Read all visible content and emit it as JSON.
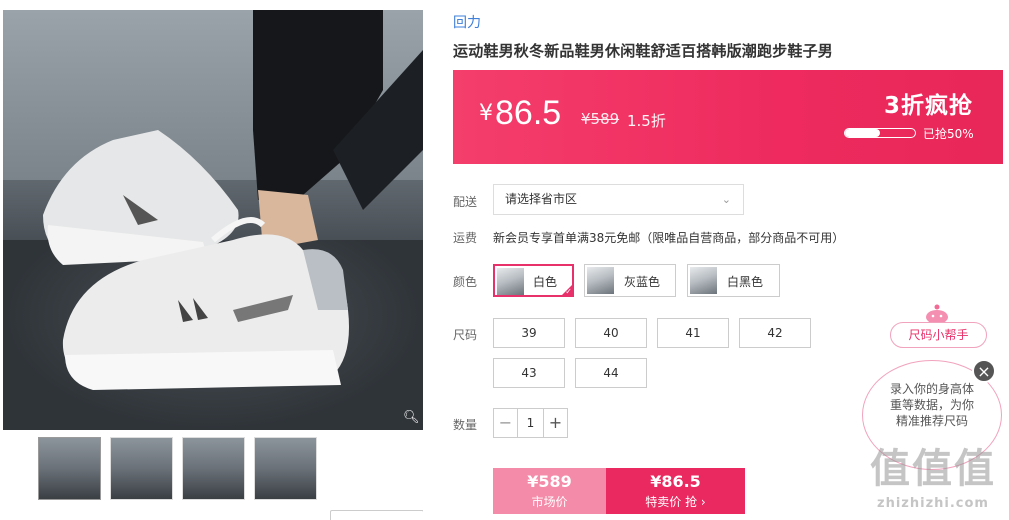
{
  "product": {
    "brand": "回力",
    "title": "运动鞋男秋冬新品鞋男休闲鞋舒适百搭韩版潮跑步鞋子男"
  },
  "price_banner": {
    "currency": "¥",
    "price": "86.5",
    "original_price": "¥589",
    "discount": "1.5折",
    "flash_label": "3折疯抢",
    "sold_progress": 0.5,
    "sold_text": "已抢50%"
  },
  "delivery": {
    "label": "配送",
    "select_value": "请选择省市区"
  },
  "shipping": {
    "label": "运费",
    "text": "新会员专享首单满38元免邮（限唯品自营商品，部分商品不可用）"
  },
  "colors": {
    "label": "颜色",
    "options": [
      {
        "name": "白色",
        "selected": true
      },
      {
        "name": "灰蓝色",
        "selected": false
      },
      {
        "name": "白黑色",
        "selected": false
      }
    ]
  },
  "sizes": {
    "label": "尺码",
    "options": [
      "39",
      "40",
      "41",
      "42",
      "43",
      "44"
    ]
  },
  "quantity": {
    "label": "数量",
    "value": "1",
    "minus": "−",
    "plus": "+"
  },
  "buy": {
    "market_price": "¥589",
    "market_label": "市场价",
    "special_price": "¥86.5",
    "special_label": "特卖价 抢 ›"
  },
  "size_helper": {
    "button": "尺码小帮手",
    "bubble_line1": "录入你的身高体",
    "bubble_line2": "重等数据，为你",
    "bubble_line3": "精准推荐尺码",
    "close": "×"
  },
  "watermark": {
    "big": "值值值",
    "url": "zhizhizhi.com"
  },
  "icons": {
    "zoom": "magnifier-icon",
    "dropdown": "chevron-down-icon",
    "close": "close-icon"
  },
  "colors_theme": {
    "accent": "#e8306a",
    "brand_link": "#3f7fd8",
    "market_button": "#f48ba8"
  }
}
